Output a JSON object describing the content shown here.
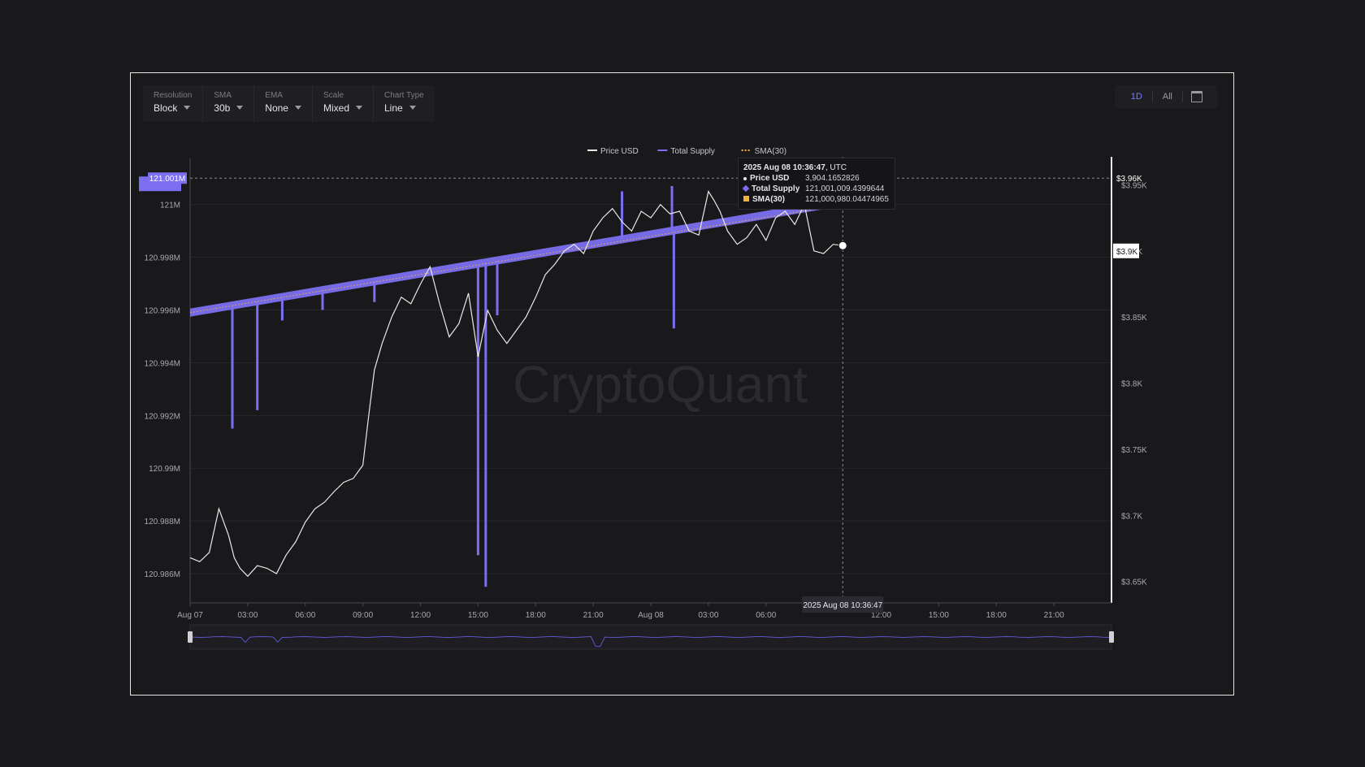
{
  "controls": [
    {
      "label": "Resolution",
      "value": "Block"
    },
    {
      "label": "SMA",
      "value": "30b"
    },
    {
      "label": "EMA",
      "value": "None"
    },
    {
      "label": "Scale",
      "value": "Mixed"
    },
    {
      "label": "Chart Type",
      "value": "Line"
    }
  ],
  "range_buttons": {
    "active": "1D",
    "all": "All"
  },
  "watermark": "CryptoQuant",
  "tooltip": {
    "time": "2025 Aug 08 10:36:47",
    "tz": ", UTC",
    "price_label": "Price USD",
    "price_value": "3,904.1652826",
    "supply_label": "Total Supply",
    "supply_value": "121,001,009.4399644",
    "sma_label": "SMA(30)",
    "sma_value": "121,000,980.04474965"
  },
  "crosshair": {
    "y_left": "121.001M",
    "y_right": "$3.96K",
    "price_tag": "$3.9K",
    "x": "2025 Aug 08 10:36:47"
  },
  "colors": {
    "price": "#e8e8e8",
    "supply": "#7b6ff0",
    "sma": "#f0b43c",
    "bg": "#19191c",
    "grid": "#26262b"
  },
  "chart_data": {
    "type": "line",
    "legend": [
      "Price USD",
      "Total Supply",
      "SMA(30)"
    ],
    "legend_position": "top-center",
    "grid": true,
    "x_ticks": [
      "Aug 07",
      "03:00",
      "06:00",
      "09:00",
      "12:00",
      "15:00",
      "18:00",
      "21:00",
      "Aug 08",
      "03:00",
      "06:00",
      "09:00",
      "12:00",
      "15:00",
      "18:00",
      "21:00"
    ],
    "y_left_ticks": [
      "121M",
      "120.998M",
      "120.996M",
      "120.994M",
      "120.992M",
      "120.99M",
      "120.988M",
      "120.986M"
    ],
    "y_left_values": [
      121.0,
      120.998,
      120.996,
      120.994,
      120.992,
      120.99,
      120.988,
      120.986
    ],
    "y_left_range": [
      120.9852,
      121.0015
    ],
    "y_right_ticks": [
      "$3.95K",
      "$3.9K",
      "$3.85K",
      "$3.8K",
      "$3.75K",
      "$3.7K",
      "$3.65K"
    ],
    "y_right_values": [
      3950,
      3900,
      3850,
      3800,
      3750,
      3700,
      3650
    ],
    "y_right_range": [
      3640,
      3965
    ],
    "x_range_hours": [
      0,
      48
    ],
    "series": [
      {
        "name": "Price USD",
        "axis": "right",
        "x": [
          0,
          0.5,
          1,
          1.5,
          2,
          2.3,
          2.6,
          3,
          3.5,
          4,
          4.5,
          5,
          5.5,
          6,
          6.5,
          7,
          7.5,
          8,
          8.5,
          9,
          9.3,
          9.6,
          10,
          10.5,
          11,
          11.5,
          12,
          12.5,
          13,
          13.5,
          14,
          14.5,
          15,
          15.5,
          16,
          16.5,
          17,
          17.5,
          18,
          18.5,
          19,
          19.5,
          20,
          20.5,
          21,
          21.5,
          22,
          22.5,
          23,
          23.5,
          24,
          24.5,
          25,
          25.5,
          26,
          26.5,
          27,
          27.3,
          27.6,
          28,
          28.5,
          29,
          29.5,
          30,
          30.5,
          31,
          31.5,
          32,
          32.5,
          33,
          33.5,
          34
        ],
        "y": [
          3668,
          3665,
          3672,
          3705,
          3685,
          3668,
          3660,
          3654,
          3662,
          3660,
          3656,
          3670,
          3680,
          3695,
          3705,
          3710,
          3718,
          3725,
          3728,
          3738,
          3775,
          3810,
          3830,
          3850,
          3865,
          3860,
          3875,
          3888,
          3860,
          3835,
          3845,
          3868,
          3820,
          3855,
          3840,
          3830,
          3840,
          3850,
          3865,
          3882,
          3890,
          3900,
          3905,
          3898,
          3915,
          3925,
          3932,
          3922,
          3915,
          3930,
          3925,
          3935,
          3928,
          3930,
          3915,
          3912,
          3945,
          3938,
          3930,
          3915,
          3905,
          3910,
          3920,
          3908,
          3925,
          3930,
          3920,
          3935,
          3900,
          3898,
          3905,
          3904
        ]
      },
      {
        "name": "Total Supply",
        "axis": "left",
        "x": [
          0,
          34
        ],
        "y": [
          120.9959,
          121.0001
        ],
        "end_x": 34,
        "end_y": 121.001,
        "dips": [
          {
            "x": 2.2,
            "y": 120.9915
          },
          {
            "x": 3.5,
            "y": 120.9922
          },
          {
            "x": 4.8,
            "y": 120.9956
          },
          {
            "x": 6.9,
            "y": 120.996
          },
          {
            "x": 9.6,
            "y": 120.9963
          },
          {
            "x": 15.0,
            "y": 120.9867
          },
          {
            "x": 15.4,
            "y": 120.9855
          },
          {
            "x": 16.0,
            "y": 120.9958
          },
          {
            "x": 22.5,
            "y": 121.0005
          },
          {
            "x": 25.2,
            "y": 120.9953
          },
          {
            "x": 25.1,
            "y": 121.0007
          }
        ]
      },
      {
        "name": "SMA(30)",
        "axis": "left",
        "x": [
          0,
          34
        ],
        "y": [
          120.9959,
          121.0
        ]
      }
    ]
  }
}
